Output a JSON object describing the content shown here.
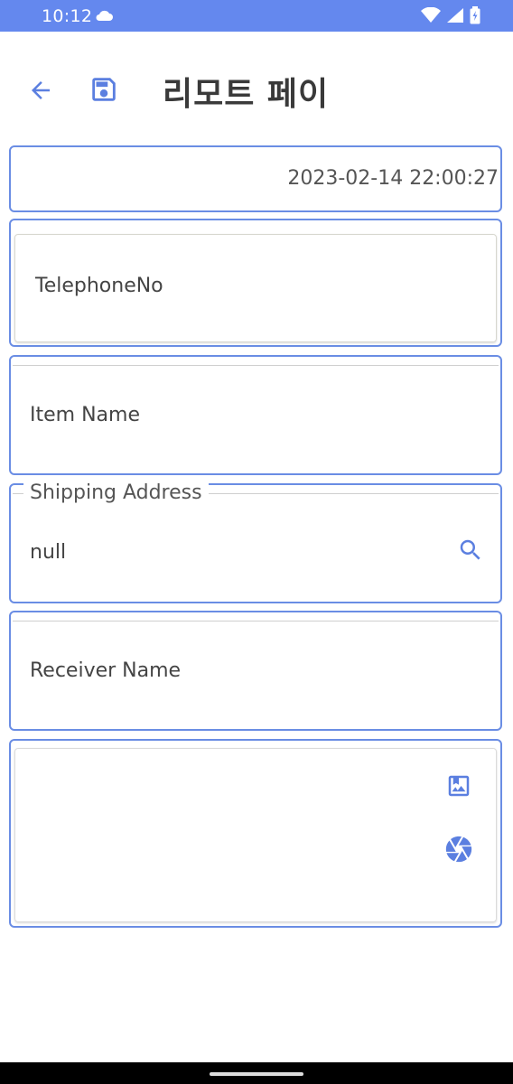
{
  "status": {
    "time": "10:12",
    "icons": [
      "cloud-icon",
      "wifi-icon",
      "signal-icon",
      "battery-icon"
    ]
  },
  "appbar": {
    "back_icon": "arrow-back-icon",
    "save_icon": "save-icon",
    "title": "리모트 페이"
  },
  "form": {
    "date": "2023-02-14 22:00:27",
    "telephone": {
      "value": "TelephoneNo"
    },
    "item_name": {
      "value": "Item Name"
    },
    "shipping_address": {
      "label": "Shipping Address",
      "value": "null",
      "icon": "search-icon"
    },
    "receiver_name": {
      "value": "Receiver Name"
    },
    "photo": {
      "gallery_icon": "gallery-icon",
      "camera_icon": "camera-icon"
    }
  },
  "colors": {
    "status_bar": "#6488ee",
    "accent": "#5b7fe0",
    "card_border": "#6a8de4"
  }
}
